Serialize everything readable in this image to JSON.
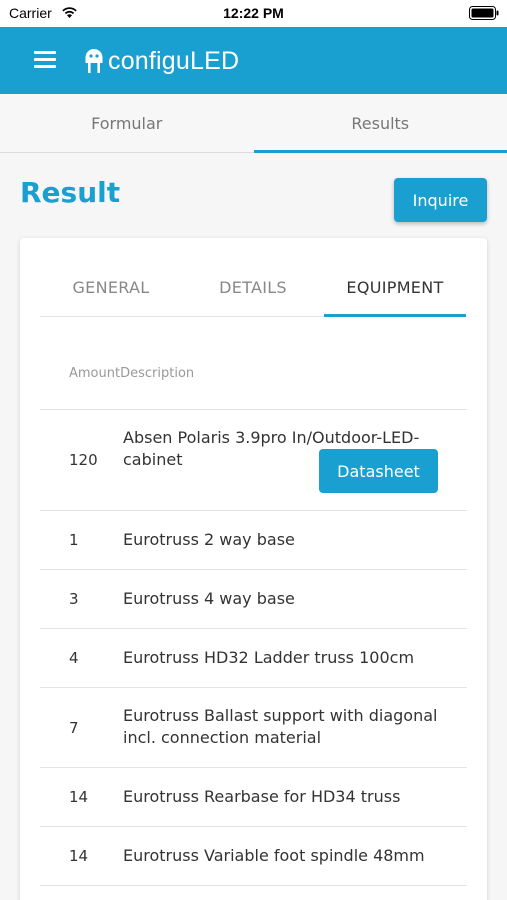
{
  "status_bar": {
    "carrier": "Carrier",
    "time": "12:22 PM",
    "wifi_icon": "wifi-icon",
    "battery_icon": "battery-icon"
  },
  "header": {
    "background": "#1aa0d0",
    "menu_icon": "hamburger-menu-icon",
    "logo_text": "configuLED"
  },
  "top_tabs": [
    {
      "label": "Formular",
      "active": false
    },
    {
      "label": "Results",
      "active": true
    }
  ],
  "result": {
    "title": "Result",
    "inquire_label": "Inquire"
  },
  "card": {
    "tabs": [
      {
        "label": "GENERAL",
        "active": false
      },
      {
        "label": "DETAILS",
        "active": false
      },
      {
        "label": "EQUIPMENT",
        "active": true
      }
    ],
    "columns": [
      "Amount",
      "Description"
    ],
    "rows": [
      {
        "amount": "120",
        "lines": [
          "Absen Polaris 3.9pro In/Outdoor-LED-",
          "cabinet"
        ],
        "button": "Datasheet"
      },
      {
        "amount": "1",
        "lines": [
          "Eurotruss 2 way base"
        ]
      },
      {
        "amount": "3",
        "lines": [
          "Eurotruss 4 way base"
        ]
      },
      {
        "amount": "4",
        "lines": [
          "Eurotruss HD32 Ladder truss 100cm"
        ]
      },
      {
        "amount": "7",
        "lines": [
          "Eurotruss Ballast support with diagonal",
          "incl. connection material"
        ]
      },
      {
        "amount": "14",
        "lines": [
          "Eurotruss Rearbase for HD34 truss"
        ]
      },
      {
        "amount": "14",
        "lines": [
          "Eurotruss Variable foot spindle 48mm"
        ]
      }
    ]
  },
  "accent_color": "#1aa0d0"
}
